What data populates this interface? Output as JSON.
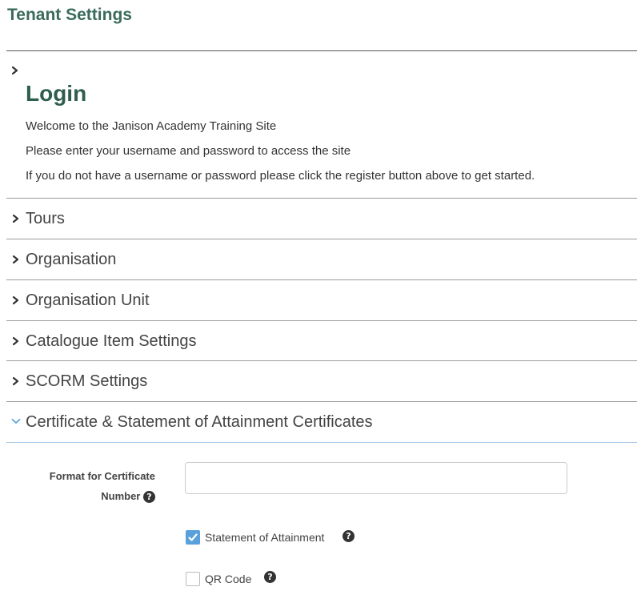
{
  "page": {
    "title": "Tenant Settings"
  },
  "login": {
    "title": "Login",
    "lines": [
      "Welcome to the Janison Academy Training Site",
      "Please enter your username and password to access the site",
      "If you do not have a username or password please click the register button above to get started."
    ]
  },
  "sections": [
    {
      "label": "Tours",
      "expanded": false
    },
    {
      "label": "Organisation",
      "expanded": false
    },
    {
      "label": "Organisation Unit",
      "expanded": false
    },
    {
      "label": "Catalogue Item Settings",
      "expanded": false
    },
    {
      "label": "SCORM Settings",
      "expanded": false
    },
    {
      "label": "Certificate & Statement of Attainment Certificates",
      "expanded": true
    }
  ],
  "certificate": {
    "format_label_line1": "Format for Certificate",
    "format_label_line2": "Number",
    "format_value": "",
    "statement_of_attainment": {
      "label": "Statement of Attainment",
      "checked": true
    },
    "qr_code": {
      "label": "QR Code",
      "checked": false
    },
    "help_glyph": "?"
  },
  "colors": {
    "title_green": "#3a6b5c",
    "login_green": "#2f5e4e",
    "accent_blue": "#5aa0dc",
    "divider_blue": "#a8c8e6"
  },
  "icons": {
    "collapsed": "chevron-right-icon",
    "expanded": "chevron-down-icon",
    "help": "question-circle-icon",
    "check": "check-icon"
  }
}
